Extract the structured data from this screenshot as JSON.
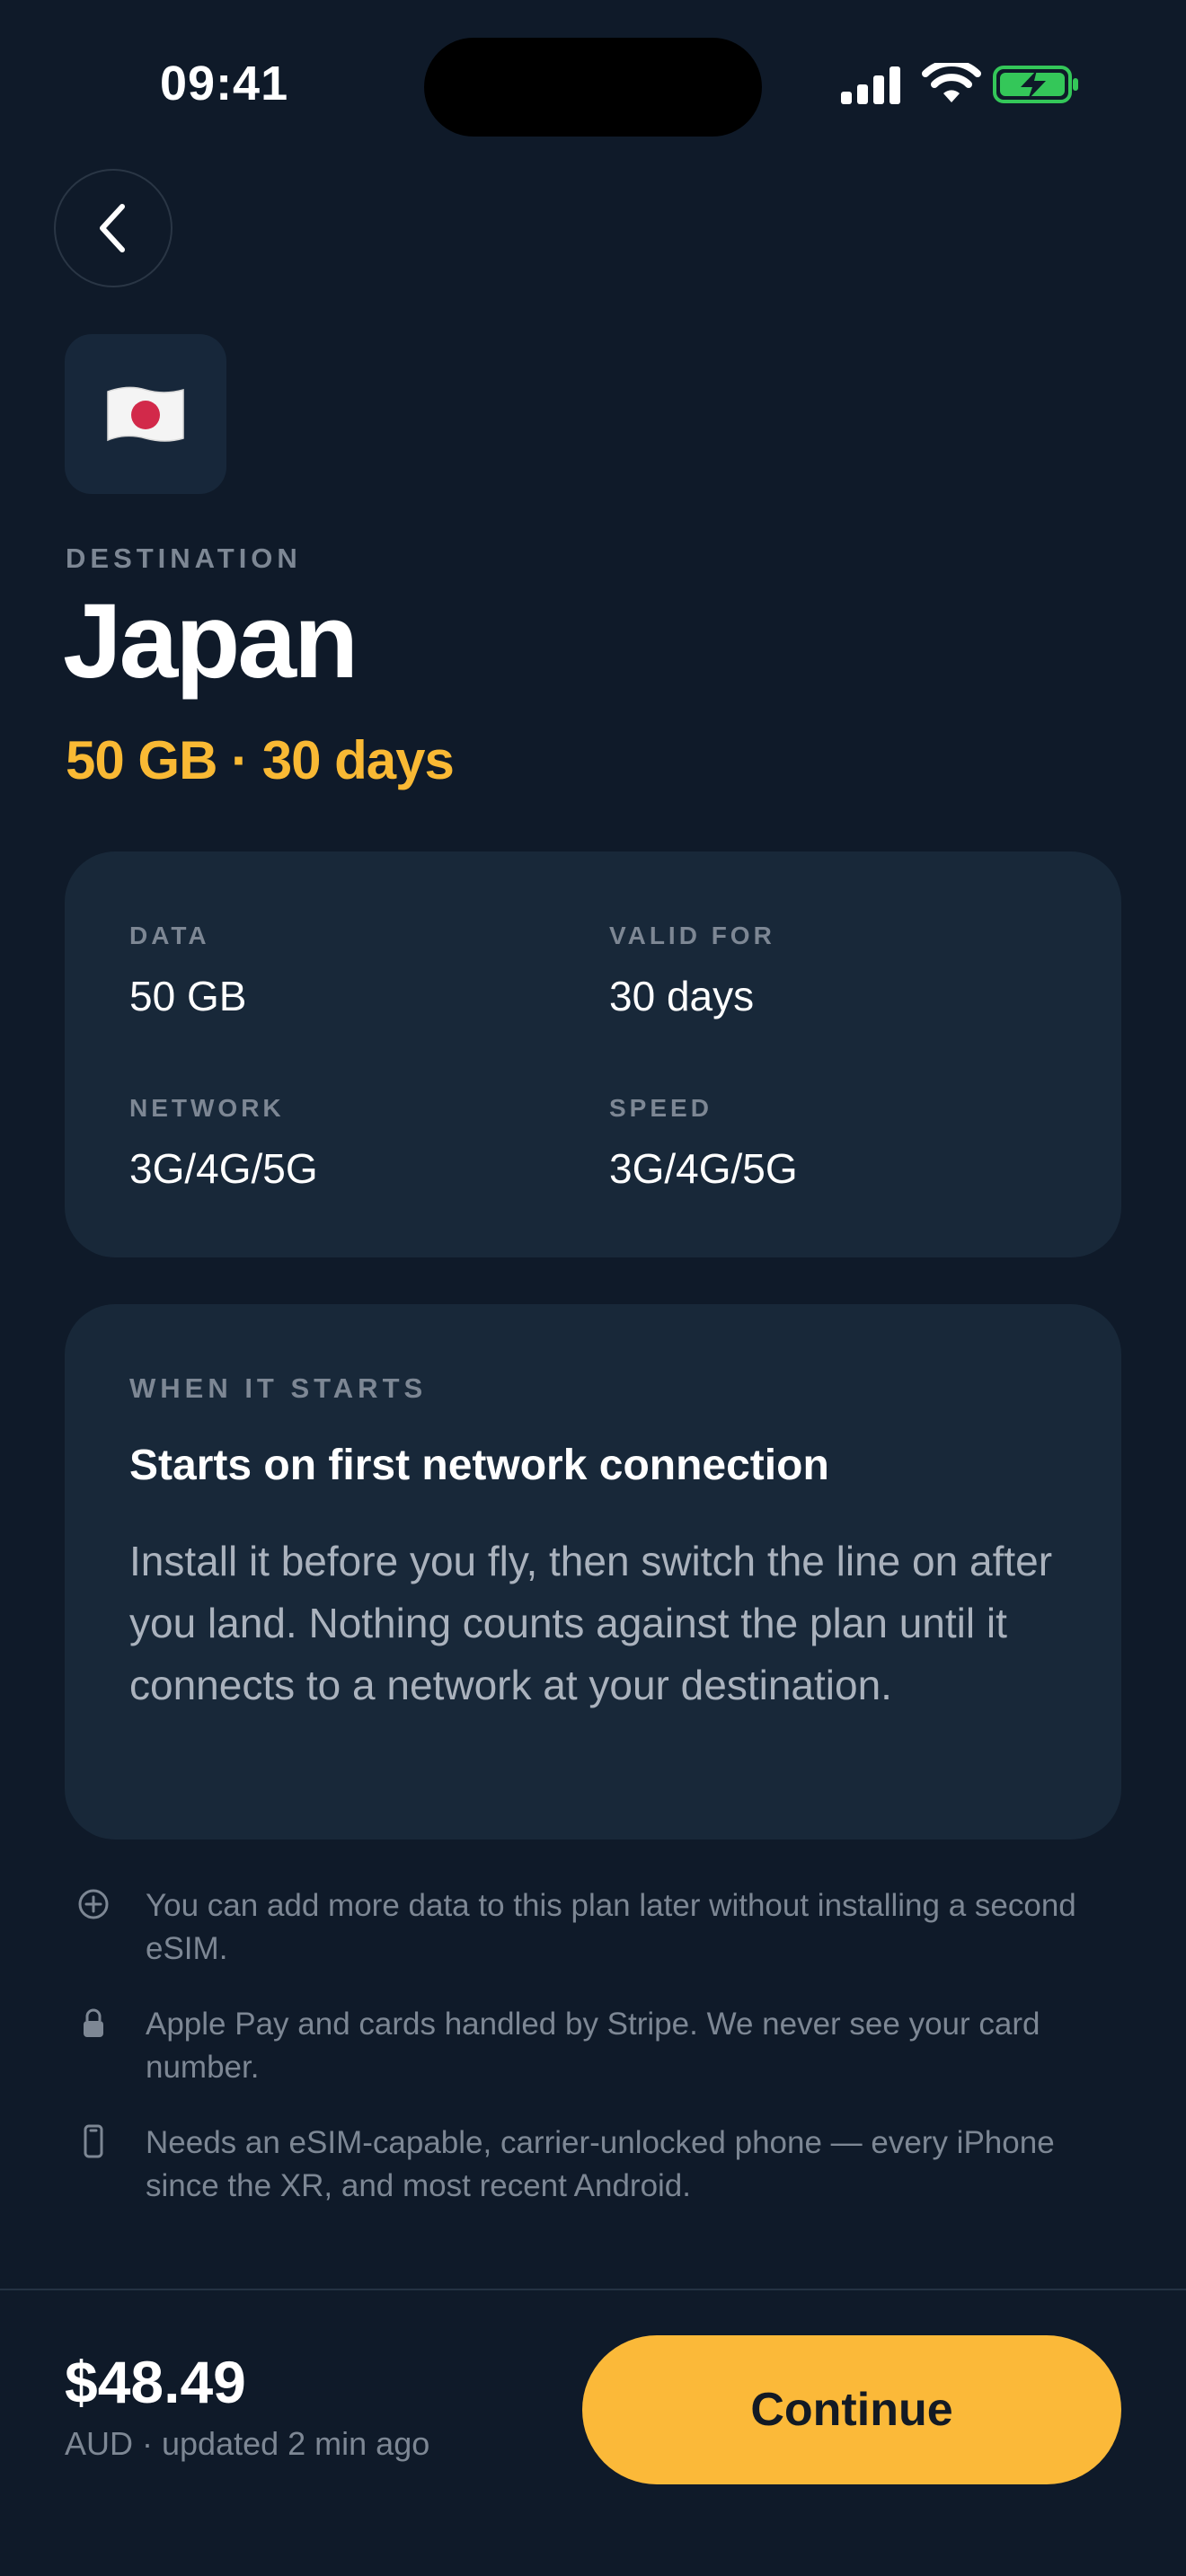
{
  "status_bar": {
    "time": "09:41"
  },
  "header": {
    "back_icon": "chevron-left-icon"
  },
  "destination": {
    "flag_icon": "japan-flag-icon",
    "label": "DESTINATION",
    "name": "Japan",
    "plan_summary": "50 GB · 30 days"
  },
  "specs": [
    {
      "key": "DATA",
      "value": "50 GB"
    },
    {
      "key": "VALID FOR",
      "value": "30 days"
    },
    {
      "key": "NETWORK",
      "value": "3G/4G/5G"
    },
    {
      "key": "SPEED",
      "value": "3G/4G/5G"
    }
  ],
  "activation": {
    "label": "WHEN IT STARTS",
    "title": "Starts on first network connection",
    "body": "Install it before you fly, then switch the line on after you land. Nothing counts against the plan until it connects to a network at your destination."
  },
  "notes": [
    {
      "icon": "plus-circle-icon",
      "text": "You can add more data to this plan later without installing a second eSIM."
    },
    {
      "icon": "lock-icon",
      "text": "Apple Pay and cards handled by Stripe. We never see your card number."
    },
    {
      "icon": "phone-icon",
      "text": "Needs an eSIM-capable, carrier-unlocked phone — every iPhone since the XR, and most recent Android."
    }
  ],
  "footer": {
    "price": "$48.49",
    "price_note": "AUD · updated 2 min ago",
    "cta_label": "Continue"
  },
  "colors": {
    "background": "#0f1a29",
    "card": "#182839",
    "accent": "#f9b934",
    "muted_text": "#7d8794",
    "battery_green": "#34c759"
  }
}
